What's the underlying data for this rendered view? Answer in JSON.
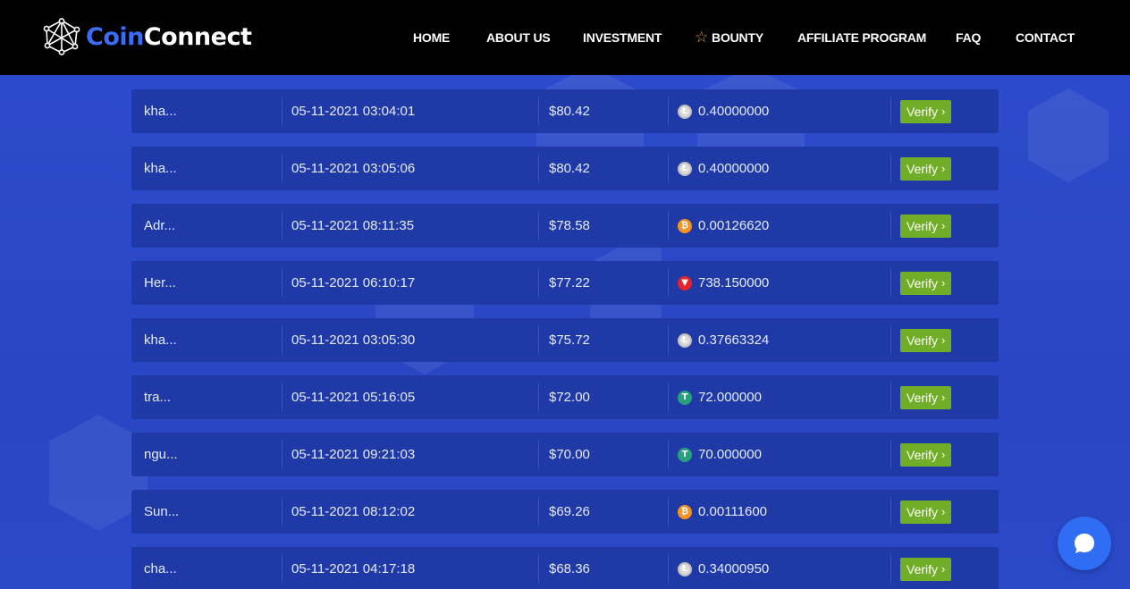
{
  "brand": {
    "part1": "Coin",
    "part2": "Connect"
  },
  "nav": {
    "home": "HOME",
    "about": "ABOUT US",
    "investment": "INVESTMENT",
    "bounty": "BOUNTY",
    "affiliate": "AFFILIATE PROGRAM",
    "faq": "FAQ",
    "contact": "CONTACT"
  },
  "colors": {
    "accent": "#3b6cf6",
    "page_bg": "#2a49c8",
    "row_bg": "#1f3aa6",
    "verify_bg": "#6fae26",
    "star": "#f4a024"
  },
  "verify_label": "Verify",
  "transactions": [
    {
      "name": "kha...",
      "date": "05-11-2021 03:04:01",
      "usd": "$80.42",
      "coin": "litecoin-icon",
      "amount": "0.40000000"
    },
    {
      "name": "kha...",
      "date": "05-11-2021 03:05:06",
      "usd": "$80.42",
      "coin": "litecoin-icon",
      "amount": "0.40000000"
    },
    {
      "name": "Adr...",
      "date": "05-11-2021 08:11:35",
      "usd": "$78.58",
      "coin": "bitcoin-icon",
      "amount": "0.00126620"
    },
    {
      "name": "Her...",
      "date": "05-11-2021 06:10:17",
      "usd": "$77.22",
      "coin": "tron-icon",
      "amount": "738.150000"
    },
    {
      "name": "kha...",
      "date": "05-11-2021 03:05:30",
      "usd": "$75.72",
      "coin": "litecoin-icon",
      "amount": "0.37663324"
    },
    {
      "name": "tra...",
      "date": "05-11-2021 05:16:05",
      "usd": "$72.00",
      "coin": "tether-icon",
      "amount": "72.000000"
    },
    {
      "name": "ngu...",
      "date": "05-11-2021 09:21:03",
      "usd": "$70.00",
      "coin": "tether-icon",
      "amount": "70.000000"
    },
    {
      "name": "Sun...",
      "date": "05-11-2021 08:12:02",
      "usd": "$69.26",
      "coin": "bitcoin-icon",
      "amount": "0.00111600"
    },
    {
      "name": "cha...",
      "date": "05-11-2021 04:17:18",
      "usd": "$68.36",
      "coin": "litecoin-icon",
      "amount": "0.34000950"
    }
  ]
}
